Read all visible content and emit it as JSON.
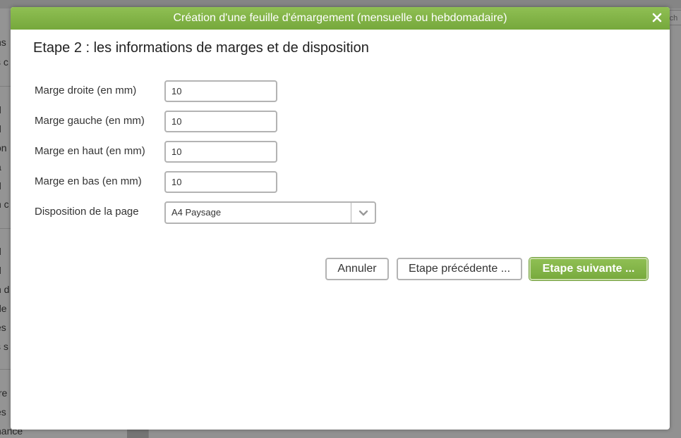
{
  "background": {
    "sidebar_fragments": [
      "ns",
      "s c",
      "d",
      "d",
      "on",
      "a",
      "d",
      "n c",
      "d",
      "d",
      "n d",
      "de",
      "es",
      "s s",
      "tre",
      "es",
      "nance"
    ],
    "search_fragment": "rch"
  },
  "modal": {
    "title": "Création d'une feuille d'émargement (mensuelle ou hebdomadaire)",
    "close_label": "×",
    "step_title": "Etape 2 : les informations de marges et de disposition"
  },
  "form": {
    "margin_right": {
      "label": "Marge droite (en mm)",
      "value": "10"
    },
    "margin_left": {
      "label": "Marge gauche (en mm)",
      "value": "10"
    },
    "margin_top": {
      "label": "Marge en haut (en mm)",
      "value": "10"
    },
    "margin_bottom": {
      "label": "Marge en bas (en mm)",
      "value": "10"
    },
    "layout": {
      "label": "Disposition de la page",
      "selected": "A4 Paysage"
    }
  },
  "buttons": {
    "cancel": "Annuler",
    "previous": "Etape précédente ...",
    "next": "Etape suivante ..."
  },
  "colors": {
    "accent_green": "#7fb046",
    "overlay": "rgba(0,0,0,0.42)"
  },
  "icons": {
    "close": "close-icon",
    "select_arrow": "chevron-down-icon"
  }
}
